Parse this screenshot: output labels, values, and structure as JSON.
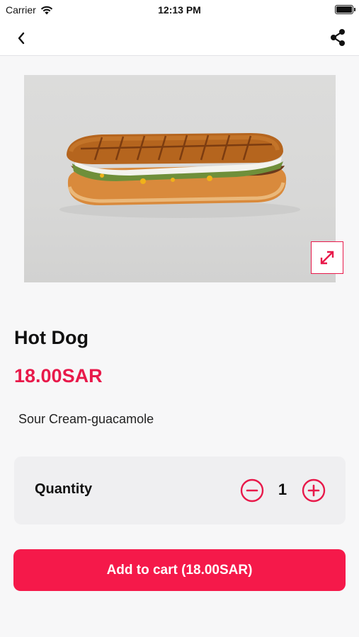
{
  "status_bar": {
    "carrier": "Carrier",
    "time": "12:13 PM"
  },
  "nav": {
    "back_icon": "chevron-left-icon",
    "share_icon": "share-icon"
  },
  "product": {
    "name": "Hot Dog",
    "price": "18.00SAR",
    "description": "Sour Cream-guacamole",
    "image_subject": "hot dog sandwich"
  },
  "quantity": {
    "label": "Quantity",
    "value": "1",
    "minus_icon": "minus-circle-icon",
    "plus_icon": "plus-circle-icon"
  },
  "cart_button": {
    "label": "Add to cart (18.00SAR)"
  },
  "colors": {
    "accent": "#f5194a",
    "price": "#e8194a",
    "background": "#f7f7f8",
    "card": "#efeff1"
  }
}
